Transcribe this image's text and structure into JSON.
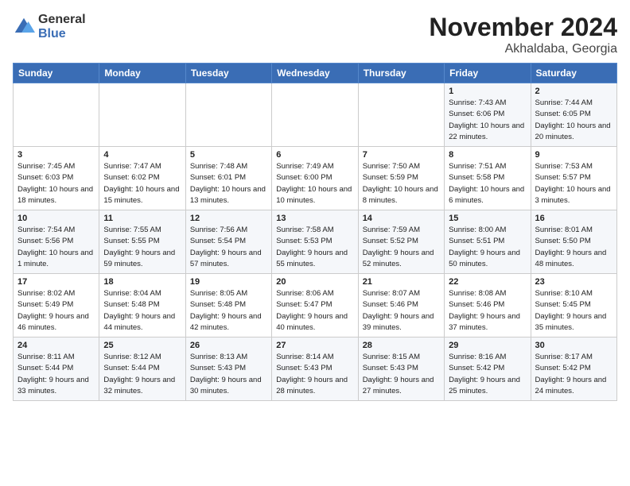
{
  "header": {
    "logo_general": "General",
    "logo_blue": "Blue",
    "month_title": "November 2024",
    "location": "Akhaldaba, Georgia"
  },
  "weekdays": [
    "Sunday",
    "Monday",
    "Tuesday",
    "Wednesday",
    "Thursday",
    "Friday",
    "Saturday"
  ],
  "weeks": [
    [
      {
        "day": "",
        "info": ""
      },
      {
        "day": "",
        "info": ""
      },
      {
        "day": "",
        "info": ""
      },
      {
        "day": "",
        "info": ""
      },
      {
        "day": "",
        "info": ""
      },
      {
        "day": "1",
        "info": "Sunrise: 7:43 AM\nSunset: 6:06 PM\nDaylight: 10 hours and 22 minutes."
      },
      {
        "day": "2",
        "info": "Sunrise: 7:44 AM\nSunset: 6:05 PM\nDaylight: 10 hours and 20 minutes."
      }
    ],
    [
      {
        "day": "3",
        "info": "Sunrise: 7:45 AM\nSunset: 6:03 PM\nDaylight: 10 hours and 18 minutes."
      },
      {
        "day": "4",
        "info": "Sunrise: 7:47 AM\nSunset: 6:02 PM\nDaylight: 10 hours and 15 minutes."
      },
      {
        "day": "5",
        "info": "Sunrise: 7:48 AM\nSunset: 6:01 PM\nDaylight: 10 hours and 13 minutes."
      },
      {
        "day": "6",
        "info": "Sunrise: 7:49 AM\nSunset: 6:00 PM\nDaylight: 10 hours and 10 minutes."
      },
      {
        "day": "7",
        "info": "Sunrise: 7:50 AM\nSunset: 5:59 PM\nDaylight: 10 hours and 8 minutes."
      },
      {
        "day": "8",
        "info": "Sunrise: 7:51 AM\nSunset: 5:58 PM\nDaylight: 10 hours and 6 minutes."
      },
      {
        "day": "9",
        "info": "Sunrise: 7:53 AM\nSunset: 5:57 PM\nDaylight: 10 hours and 3 minutes."
      }
    ],
    [
      {
        "day": "10",
        "info": "Sunrise: 7:54 AM\nSunset: 5:56 PM\nDaylight: 10 hours and 1 minute."
      },
      {
        "day": "11",
        "info": "Sunrise: 7:55 AM\nSunset: 5:55 PM\nDaylight: 9 hours and 59 minutes."
      },
      {
        "day": "12",
        "info": "Sunrise: 7:56 AM\nSunset: 5:54 PM\nDaylight: 9 hours and 57 minutes."
      },
      {
        "day": "13",
        "info": "Sunrise: 7:58 AM\nSunset: 5:53 PM\nDaylight: 9 hours and 55 minutes."
      },
      {
        "day": "14",
        "info": "Sunrise: 7:59 AM\nSunset: 5:52 PM\nDaylight: 9 hours and 52 minutes."
      },
      {
        "day": "15",
        "info": "Sunrise: 8:00 AM\nSunset: 5:51 PM\nDaylight: 9 hours and 50 minutes."
      },
      {
        "day": "16",
        "info": "Sunrise: 8:01 AM\nSunset: 5:50 PM\nDaylight: 9 hours and 48 minutes."
      }
    ],
    [
      {
        "day": "17",
        "info": "Sunrise: 8:02 AM\nSunset: 5:49 PM\nDaylight: 9 hours and 46 minutes."
      },
      {
        "day": "18",
        "info": "Sunrise: 8:04 AM\nSunset: 5:48 PM\nDaylight: 9 hours and 44 minutes."
      },
      {
        "day": "19",
        "info": "Sunrise: 8:05 AM\nSunset: 5:48 PM\nDaylight: 9 hours and 42 minutes."
      },
      {
        "day": "20",
        "info": "Sunrise: 8:06 AM\nSunset: 5:47 PM\nDaylight: 9 hours and 40 minutes."
      },
      {
        "day": "21",
        "info": "Sunrise: 8:07 AM\nSunset: 5:46 PM\nDaylight: 9 hours and 39 minutes."
      },
      {
        "day": "22",
        "info": "Sunrise: 8:08 AM\nSunset: 5:46 PM\nDaylight: 9 hours and 37 minutes."
      },
      {
        "day": "23",
        "info": "Sunrise: 8:10 AM\nSunset: 5:45 PM\nDaylight: 9 hours and 35 minutes."
      }
    ],
    [
      {
        "day": "24",
        "info": "Sunrise: 8:11 AM\nSunset: 5:44 PM\nDaylight: 9 hours and 33 minutes."
      },
      {
        "day": "25",
        "info": "Sunrise: 8:12 AM\nSunset: 5:44 PM\nDaylight: 9 hours and 32 minutes."
      },
      {
        "day": "26",
        "info": "Sunrise: 8:13 AM\nSunset: 5:43 PM\nDaylight: 9 hours and 30 minutes."
      },
      {
        "day": "27",
        "info": "Sunrise: 8:14 AM\nSunset: 5:43 PM\nDaylight: 9 hours and 28 minutes."
      },
      {
        "day": "28",
        "info": "Sunrise: 8:15 AM\nSunset: 5:43 PM\nDaylight: 9 hours and 27 minutes."
      },
      {
        "day": "29",
        "info": "Sunrise: 8:16 AM\nSunset: 5:42 PM\nDaylight: 9 hours and 25 minutes."
      },
      {
        "day": "30",
        "info": "Sunrise: 8:17 AM\nSunset: 5:42 PM\nDaylight: 9 hours and 24 minutes."
      }
    ]
  ]
}
